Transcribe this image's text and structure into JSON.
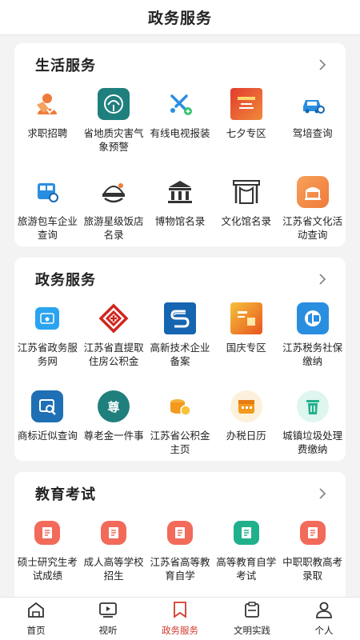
{
  "header": {
    "title": "政务服务"
  },
  "sections": [
    {
      "title": "生活服务",
      "items": [
        {
          "label": "求职招聘",
          "icon": "job-icon"
        },
        {
          "label": "省地质灾害气象预警",
          "icon": "weather-disaster-icon"
        },
        {
          "label": "有线电视报装",
          "icon": "cable-tv-icon"
        },
        {
          "label": "七夕专区",
          "icon": "qixi-icon"
        },
        {
          "label": "驾培查询",
          "icon": "car-search-icon"
        },
        {
          "label": "旅游包车企业查询",
          "icon": "bus-search-icon"
        },
        {
          "label": "旅游星级饭店名录",
          "icon": "hotel-icon"
        },
        {
          "label": "博物馆名录",
          "icon": "museum-icon"
        },
        {
          "label": "文化馆名录",
          "icon": "culture-hall-icon"
        },
        {
          "label": "江苏省文化活动查询",
          "icon": "culture-activity-icon"
        }
      ]
    },
    {
      "title": "政务服务",
      "items": [
        {
          "label": "江苏省政务服务网",
          "icon": "gov-service-icon"
        },
        {
          "label": "江苏省直提取住房公积金",
          "icon": "housing-fund-icon"
        },
        {
          "label": "高新技术企业备案",
          "icon": "hightech-icon"
        },
        {
          "label": "国庆专区",
          "icon": "national-day-icon"
        },
        {
          "label": "江苏税务社保缴纳",
          "icon": "tax-icon"
        },
        {
          "label": "商标近似查询",
          "icon": "trademark-icon"
        },
        {
          "label": "尊老金一件事",
          "icon": "elder-fund-icon"
        },
        {
          "label": "江苏省公积金主页",
          "icon": "fund-coin-icon"
        },
        {
          "label": "办税日历",
          "icon": "tax-calendar-icon"
        },
        {
          "label": "城镇垃圾处理费缴纳",
          "icon": "trash-icon"
        }
      ]
    },
    {
      "title": "教育考试",
      "items": [
        {
          "label": "硕士研究生考试成绩",
          "icon": "exam-doc-icon"
        },
        {
          "label": "成人高等学校招生",
          "icon": "exam-doc-icon"
        },
        {
          "label": "江苏省高等教育自学",
          "icon": "exam-doc-icon"
        },
        {
          "label": "高等教育自学考试",
          "icon": "self-study-icon"
        },
        {
          "label": "中职职教高考录取",
          "icon": "exam-doc-icon"
        }
      ]
    }
  ],
  "tabs": [
    {
      "label": "首页",
      "icon": "home-icon"
    },
    {
      "label": "视听",
      "icon": "video-icon"
    },
    {
      "label": "政务服务",
      "icon": "bookmark-icon",
      "active": true
    },
    {
      "label": "文明实践",
      "icon": "clipboard-icon"
    },
    {
      "label": "个人",
      "icon": "person-icon"
    }
  ],
  "colors": {
    "accent": "#d23a2a",
    "teal": "#1f7f7d",
    "blue": "#2a8ee0"
  }
}
